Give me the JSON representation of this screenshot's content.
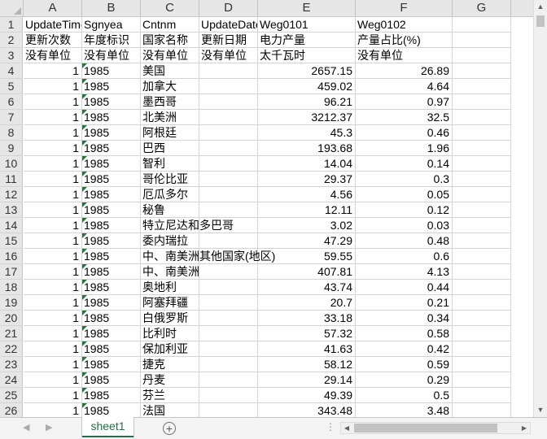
{
  "columns": [
    "A",
    "B",
    "C",
    "D",
    "E",
    "F",
    "G"
  ],
  "rows": [
    {
      "n": "1",
      "a": "UpdateTime",
      "b": "Sgnyea",
      "c": "Cntnm",
      "d": "UpdateDate",
      "e": "Weg0101",
      "f": "Weg0102"
    },
    {
      "n": "2",
      "a": "更新次数",
      "b": "年度标识",
      "c": "国家名称",
      "d": "更新日期",
      "e": "电力产量",
      "f": "产量占比(%)"
    },
    {
      "n": "3",
      "a": "没有单位",
      "b": "没有单位",
      "c": "没有单位",
      "d": "没有单位",
      "e": "太千瓦时",
      "f": "没有单位"
    },
    {
      "n": "4",
      "a": "1",
      "b": "1985",
      "c": "美国",
      "d": "",
      "e": "2657.15",
      "f": "26.89"
    },
    {
      "n": "5",
      "a": "1",
      "b": "1985",
      "c": "加拿大",
      "d": "",
      "e": "459.02",
      "f": "4.64"
    },
    {
      "n": "6",
      "a": "1",
      "b": "1985",
      "c": "墨西哥",
      "d": "",
      "e": "96.21",
      "f": "0.97"
    },
    {
      "n": "7",
      "a": "1",
      "b": "1985",
      "c": "北美洲",
      "d": "",
      "e": "3212.37",
      "f": "32.5"
    },
    {
      "n": "8",
      "a": "1",
      "b": "1985",
      "c": "阿根廷",
      "d": "",
      "e": "45.3",
      "f": "0.46"
    },
    {
      "n": "9",
      "a": "1",
      "b": "1985",
      "c": "巴西",
      "d": "",
      "e": "193.68",
      "f": "1.96"
    },
    {
      "n": "10",
      "a": "1",
      "b": "1985",
      "c": "智利",
      "d": "",
      "e": "14.04",
      "f": "0.14"
    },
    {
      "n": "11",
      "a": "1",
      "b": "1985",
      "c": "哥伦比亚",
      "d": "",
      "e": "29.37",
      "f": "0.3"
    },
    {
      "n": "12",
      "a": "1",
      "b": "1985",
      "c": "厄瓜多尔",
      "d": "",
      "e": "4.56",
      "f": "0.05"
    },
    {
      "n": "13",
      "a": "1",
      "b": "1985",
      "c": "秘鲁",
      "d": "",
      "e": "12.11",
      "f": "0.12"
    },
    {
      "n": "14",
      "a": "1",
      "b": "1985",
      "c": "特立尼达和多巴哥",
      "d": "",
      "e": "3.02",
      "f": "0.03"
    },
    {
      "n": "15",
      "a": "1",
      "b": "1985",
      "c": "委内瑞拉",
      "d": "",
      "e": "47.29",
      "f": "0.48"
    },
    {
      "n": "16",
      "a": "1",
      "b": "1985",
      "c": "中、南美洲其他国家(地区)",
      "d": "",
      "e": "59.55",
      "f": "0.6"
    },
    {
      "n": "17",
      "a": "1",
      "b": "1985",
      "c": "中、南美洲",
      "d": "",
      "e": "407.81",
      "f": "4.13"
    },
    {
      "n": "18",
      "a": "1",
      "b": "1985",
      "c": "奥地利",
      "d": "",
      "e": "43.74",
      "f": "0.44"
    },
    {
      "n": "19",
      "a": "1",
      "b": "1985",
      "c": "阿塞拜疆",
      "d": "",
      "e": "20.7",
      "f": "0.21"
    },
    {
      "n": "20",
      "a": "1",
      "b": "1985",
      "c": "白俄罗斯",
      "d": "",
      "e": "33.18",
      "f": "0.34"
    },
    {
      "n": "21",
      "a": "1",
      "b": "1985",
      "c": "比利时",
      "d": "",
      "e": "57.32",
      "f": "0.58"
    },
    {
      "n": "22",
      "a": "1",
      "b": "1985",
      "c": "保加利亚",
      "d": "",
      "e": "41.63",
      "f": "0.42"
    },
    {
      "n": "23",
      "a": "1",
      "b": "1985",
      "c": "捷克",
      "d": "",
      "e": "58.12",
      "f": "0.59"
    },
    {
      "n": "24",
      "a": "1",
      "b": "1985",
      "c": "丹麦",
      "d": "",
      "e": "29.14",
      "f": "0.29"
    },
    {
      "n": "25",
      "a": "1",
      "b": "1985",
      "c": "芬兰",
      "d": "",
      "e": "49.39",
      "f": "0.5"
    },
    {
      "n": "26",
      "a": "1",
      "b": "1985",
      "c": "法国",
      "d": "",
      "e": "343.48",
      "f": "3.48"
    }
  ],
  "sheet_tab": "sheet1",
  "icons": {
    "add_sheet": "plus-circle-icon",
    "prev": "triangle-left-icon",
    "next": "triangle-right-icon"
  }
}
